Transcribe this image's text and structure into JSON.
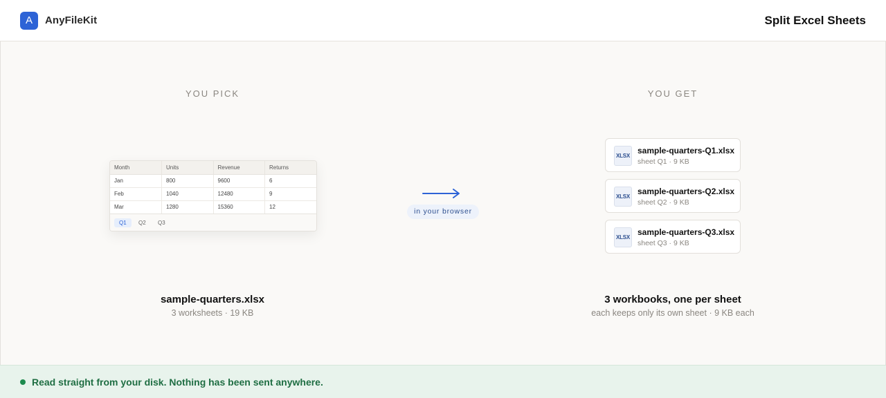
{
  "header": {
    "logo_letter": "A",
    "brand": "AnyFileKit",
    "title": "Split Excel Sheets"
  },
  "input": {
    "heading": "YOU PICK",
    "sheet": {
      "columns": [
        "Month",
        "Units",
        "Revenue",
        "Returns"
      ],
      "rows": [
        [
          "Jan",
          "800",
          "9600",
          "6"
        ],
        [
          "Feb",
          "1040",
          "12480",
          "9"
        ],
        [
          "Mar",
          "1280",
          "15360",
          "12"
        ]
      ],
      "tabs": [
        "Q1",
        "Q2",
        "Q3"
      ],
      "active_tab": "Q1"
    },
    "filename": "sample-quarters.xlsx",
    "details": "3 worksheets · 19 KB"
  },
  "transfer": {
    "label": "in your browser"
  },
  "output": {
    "heading": "YOU GET",
    "files": [
      {
        "icon_label": "XLSX",
        "name": "sample-quarters-Q1.xlsx",
        "meta": "sheet Q1 · 9 KB"
      },
      {
        "icon_label": "XLSX",
        "name": "sample-quarters-Q2.xlsx",
        "meta": "sheet Q2 · 9 KB"
      },
      {
        "icon_label": "XLSX",
        "name": "sample-quarters-Q3.xlsx",
        "meta": "sheet Q3 · 9 KB"
      }
    ],
    "summary": "3 workbooks, one per sheet",
    "details": "each keeps only its own sheet · 9 KB each"
  },
  "footer": {
    "status": "Read straight from your disk. Nothing has been sent anywhere."
  },
  "colors": {
    "accent": "#2d63d6",
    "success": "#1d8a4e",
    "footer_bg": "#e8f3ec"
  }
}
